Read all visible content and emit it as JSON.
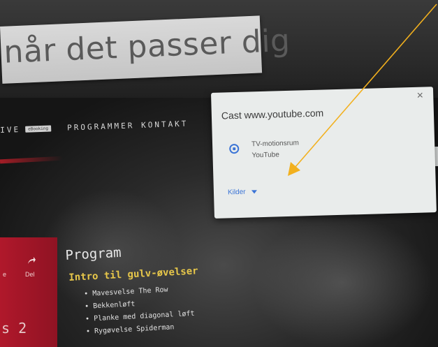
{
  "sticker": {
    "text": "når det passer dig"
  },
  "website": {
    "nav": {
      "left_fragment": "IVE",
      "badge": "eBooking",
      "items": [
        "PROGRAMMER",
        "KONTAKT"
      ]
    },
    "side_panel": {
      "share_label": "Del",
      "fragment_label": "e",
      "page_fragment": "s 2"
    },
    "program": {
      "title": "Program",
      "subtitle": "Intro til gulv-øvelser",
      "exercises": [
        "Mavesvelse The Row",
        "Bekkenløft",
        "Planke med diagonal løft",
        "Rygøvelse Spiderman"
      ]
    }
  },
  "cast_dialog": {
    "title": "Cast www.youtube.com",
    "close_glyph": "×",
    "sink": {
      "name": "TV-motionsrum",
      "status": "YouTube"
    },
    "sources_label": "Kilder",
    "edge_fragment": "O"
  },
  "colors": {
    "annotation_arrow": "#f2b01e",
    "cast_accent": "#3b74d6",
    "subtitle_yellow": "#e7c74a",
    "side_panel_red": "#b0182b"
  }
}
